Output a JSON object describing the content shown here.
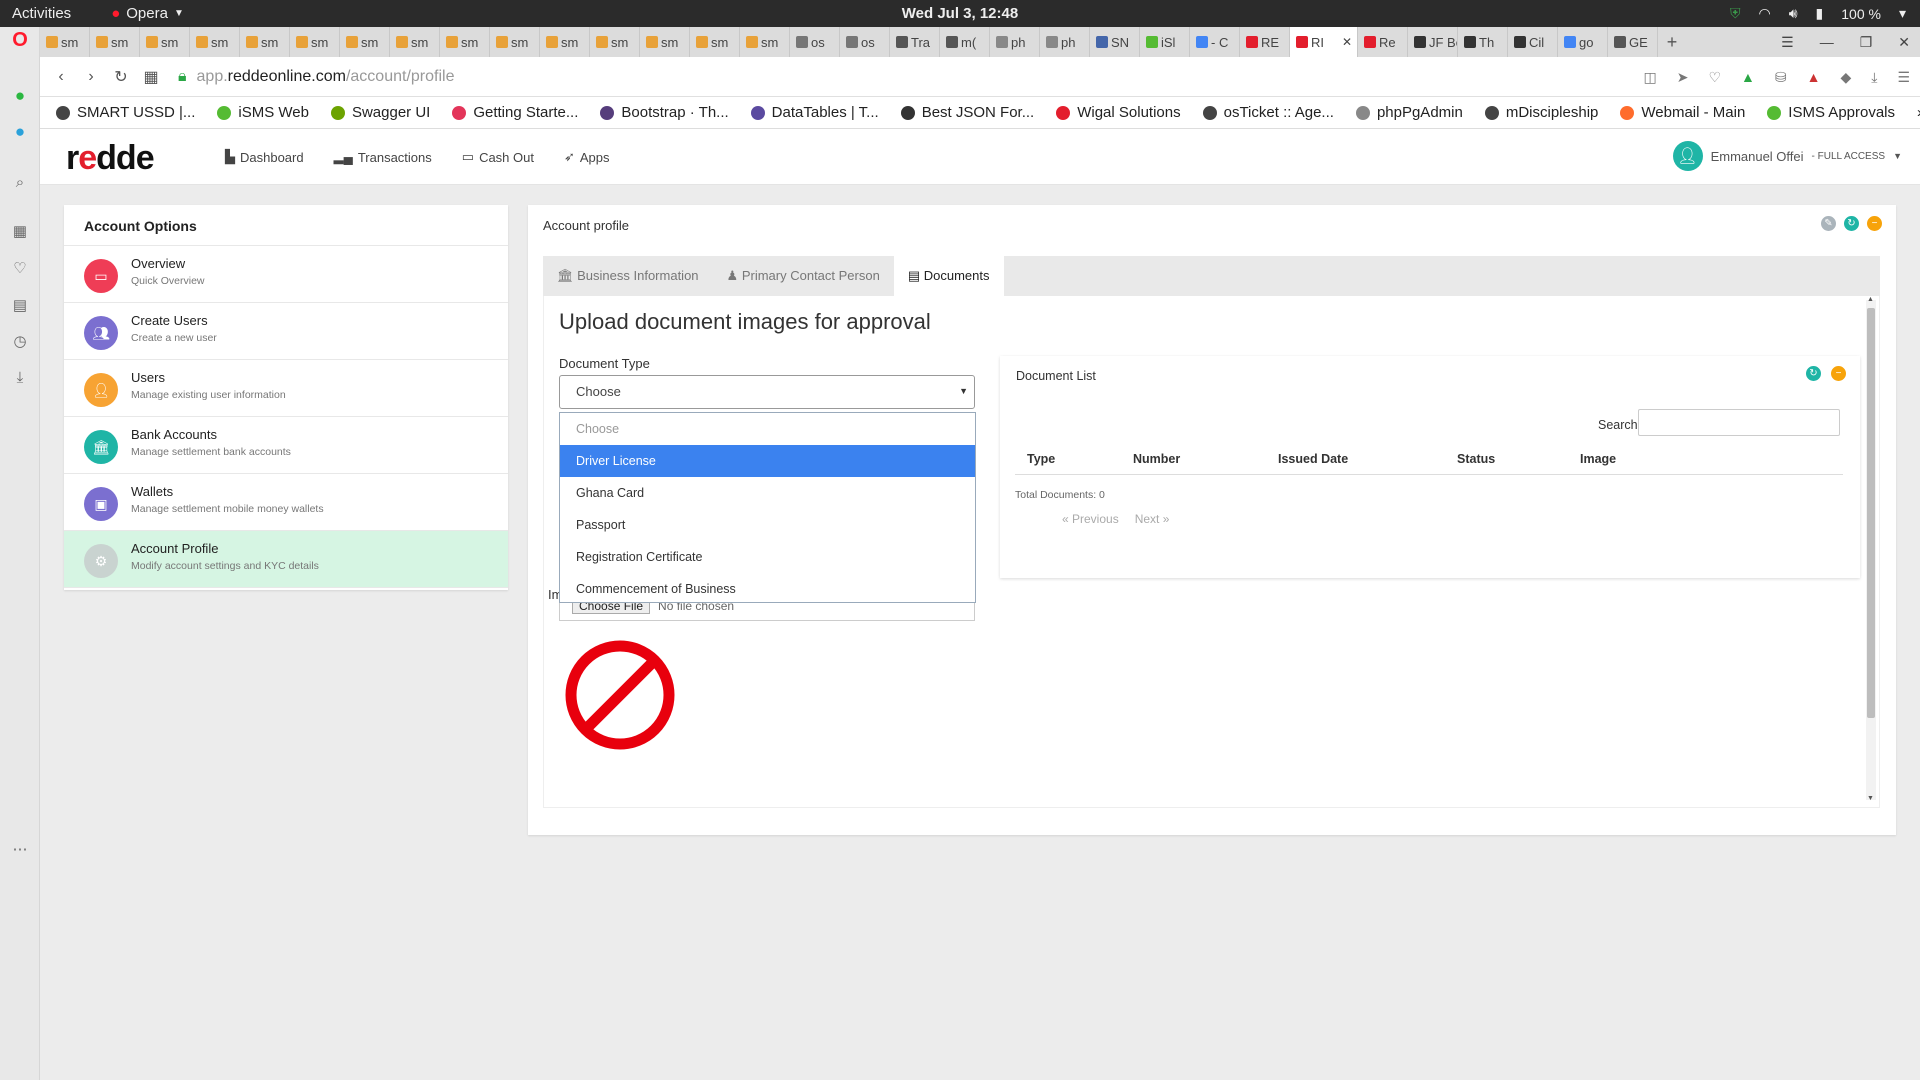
{
  "os_bar": {
    "activities": "Activities",
    "app_name": "Opera",
    "clock": "Wed Jul  3, 12:48",
    "battery": "100 %"
  },
  "tabs": [
    {
      "label": "sm",
      "color": "#e8a23a"
    },
    {
      "label": "sm",
      "color": "#e8a23a"
    },
    {
      "label": "sm",
      "color": "#e8a23a"
    },
    {
      "label": "sm",
      "color": "#e8a23a"
    },
    {
      "label": "sm",
      "color": "#e8a23a"
    },
    {
      "label": "sm",
      "color": "#e8a23a"
    },
    {
      "label": "sm",
      "color": "#e8a23a"
    },
    {
      "label": "sm",
      "color": "#e8a23a"
    },
    {
      "label": "sm",
      "color": "#e8a23a"
    },
    {
      "label": "sm",
      "color": "#e8a23a"
    },
    {
      "label": "sm",
      "color": "#e8a23a"
    },
    {
      "label": "sm",
      "color": "#e8a23a"
    },
    {
      "label": "sm",
      "color": "#e8a23a"
    },
    {
      "label": "sm",
      "color": "#e8a23a"
    },
    {
      "label": "sm",
      "color": "#e8a23a"
    },
    {
      "label": "os",
      "color": "#777777"
    },
    {
      "label": "os",
      "color": "#777777"
    },
    {
      "label": "Tra",
      "color": "#555555"
    },
    {
      "label": "m(",
      "color": "#555555"
    },
    {
      "label": "ph",
      "color": "#888888"
    },
    {
      "label": "ph",
      "color": "#888888"
    },
    {
      "label": "SN",
      "color": "#4466aa"
    },
    {
      "label": "iSl",
      "color": "#55bb33"
    },
    {
      "label": "- C",
      "color": "#4285f4"
    },
    {
      "label": "RE",
      "color": "#e31e2d"
    },
    {
      "label": "RI",
      "color": "#e31e2d",
      "active": true
    },
    {
      "label": "Re",
      "color": "#e31e2d"
    },
    {
      "label": "JF Be",
      "color": "#333333"
    },
    {
      "label": "Th",
      "color": "#333333"
    },
    {
      "label": "Cil",
      "color": "#333333"
    },
    {
      "label": "go",
      "color": "#4285f4"
    },
    {
      "label": "GE",
      "color": "#555555"
    }
  ],
  "address": {
    "prefix": "app.",
    "host": "reddeonline.com",
    "path": "/account/profile"
  },
  "bookmarks": [
    {
      "label": "SMART USSD |...",
      "color": "#444444"
    },
    {
      "label": "iSMS Web",
      "color": "#55bb33"
    },
    {
      "label": "Swagger UI",
      "color": "#6ca300"
    },
    {
      "label": "Getting Starte...",
      "color": "#e3355a"
    },
    {
      "label": "Bootstrap · Th...",
      "color": "#563d7c"
    },
    {
      "label": "DataTables | T...",
      "color": "#5b4aa0"
    },
    {
      "label": "Best JSON For...",
      "color": "#333333"
    },
    {
      "label": "Wigal Solutions",
      "color": "#e31e2d"
    },
    {
      "label": "osTicket :: Age...",
      "color": "#444444"
    },
    {
      "label": "phpPgAdmin",
      "color": "#888888"
    },
    {
      "label": "mDiscipleship",
      "color": "#444444"
    },
    {
      "label": "Webmail - Main",
      "color": "#ff6c2c"
    },
    {
      "label": "ISMS Approvals",
      "color": "#55bb33"
    }
  ],
  "header": {
    "logo_r": "r",
    "logo_e": "e",
    "logo_rest": "dde",
    "nav": [
      {
        "label": "Dashboard",
        "icon": "chart-icon"
      },
      {
        "label": "Transactions",
        "icon": "bars-icon"
      },
      {
        "label": "Cash Out",
        "icon": "folder-icon"
      },
      {
        "label": "Apps",
        "icon": "rocket-icon"
      }
    ],
    "user_name": "Emmanuel Offei",
    "user_access": " - FULL ACCESS"
  },
  "account_options": {
    "title": "Account Options",
    "items": [
      {
        "title": "Overview",
        "subtitle": "Quick Overview",
        "color": "#ef3d56"
      },
      {
        "title": "Create Users",
        "subtitle": "Create a new user",
        "color": "#7b6fd0"
      },
      {
        "title": "Users",
        "subtitle": "Manage existing user information",
        "color": "#f7a333"
      },
      {
        "title": "Bank Accounts",
        "subtitle": "Manage settlement bank accounts",
        "color": "#1fb5a6"
      },
      {
        "title": "Wallets",
        "subtitle": "Manage settlement mobile money wallets",
        "color": "#7b6fd0"
      },
      {
        "title": "Account Profile",
        "subtitle": "Modify account settings and KYC details",
        "color": "#c9d3d0"
      }
    ]
  },
  "profile": {
    "title": "Account profile",
    "tabs": [
      "Business Information",
      "Primary Contact Person",
      "Documents"
    ],
    "active_tab": 2,
    "upload_title": "Upload document images for approval",
    "doc_type_label": "Document Type",
    "select_value": "Choose",
    "options": [
      "Choose",
      "Driver License",
      "Ghana Card",
      "Passport",
      "Registration Certificate",
      "Commencement of Business"
    ],
    "selected_option": 1,
    "image_label_fragment": "Im",
    "file_button": "Choose File",
    "file_status": "No file chosen"
  },
  "document_list": {
    "title": "Document List",
    "search_label": "Search",
    "columns": [
      "Type",
      "Number",
      "Issued Date",
      "Status",
      "Image"
    ],
    "total_text": "Total Documents: 0",
    "prev": "«  Previous",
    "next": "Next  »"
  },
  "colors": {
    "accent_blue": "#3b82ef",
    "teal": "#1fb5a6",
    "orange": "#f7a30a",
    "red": "#e31e2d"
  }
}
